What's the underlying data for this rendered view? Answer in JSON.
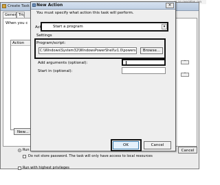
{
  "background": {
    "top_right_text": "rs an operation con"
  },
  "back_window": {
    "title": "Create Task",
    "tabs": [
      "General",
      "Trig"
    ],
    "when_text": "When you c",
    "actions_column_header": "Action",
    "new_button_label": "New...",
    "side_up_label": "˄",
    "side_down_label": "˅",
    "cancel_button_label": "Cancel",
    "security": {
      "run_logged_on_label": "Run whether user is logged on or not",
      "do_not_store_password_label": "Do not store password.  The task will only have access to local resources",
      "run_highest_label": "Run with highest privileges"
    }
  },
  "dialog": {
    "title": "New Action",
    "close_label": "×",
    "instruction": "You must specify what action this task will perform.",
    "action_label": "Action:",
    "action_value": "Start a program",
    "dropdown_arrow": "▾",
    "settings_label": "Settings",
    "program_label": "Program/script:",
    "program_value": "C:\\Windows\\System32\\WindowsPowerShell\\v1.0\\powers",
    "browse_label": "Browse...",
    "args_label": "Add arguments (optional):",
    "args_value": "",
    "start_in_label": "Start in (optional):",
    "start_in_value": "",
    "ok_label": "OK",
    "cancel_label": "Cancel"
  }
}
